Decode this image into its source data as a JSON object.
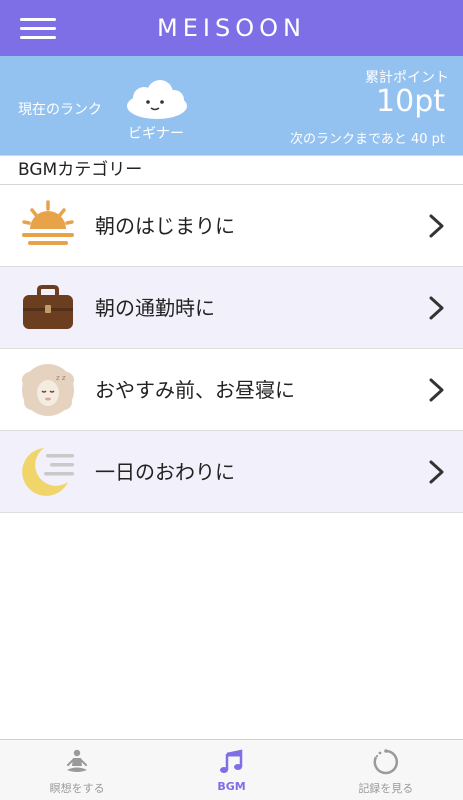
{
  "header": {
    "title": "MEISOON"
  },
  "rank": {
    "current_label": "現在のランク",
    "rank_name": "ビギナー",
    "points_label": "累計ポイント",
    "points_value": "10pt",
    "next_rank_text": "次のランクまであと 40 pt"
  },
  "category_header": "BGMカテゴリー",
  "categories": [
    {
      "label": "朝のはじまりに",
      "icon": "sunrise-icon"
    },
    {
      "label": "朝の通勤時に",
      "icon": "briefcase-icon"
    },
    {
      "label": "おやすみ前、お昼寝に",
      "icon": "sheep-icon"
    },
    {
      "label": "一日のおわりに",
      "icon": "moon-icon"
    }
  ],
  "tabs": [
    {
      "label": "瞑想をする",
      "icon": "meditation-icon",
      "active": false
    },
    {
      "label": "BGM",
      "icon": "music-note-icon",
      "active": true
    },
    {
      "label": "記録を見る",
      "icon": "record-icon",
      "active": false
    }
  ],
  "colors": {
    "header": "#7e6fe6",
    "rank_panel": "#94c2f0",
    "active_tab": "#7e6fe6",
    "inactive_tab": "#9a9a9a",
    "alt_row": "#f2f0fa"
  }
}
